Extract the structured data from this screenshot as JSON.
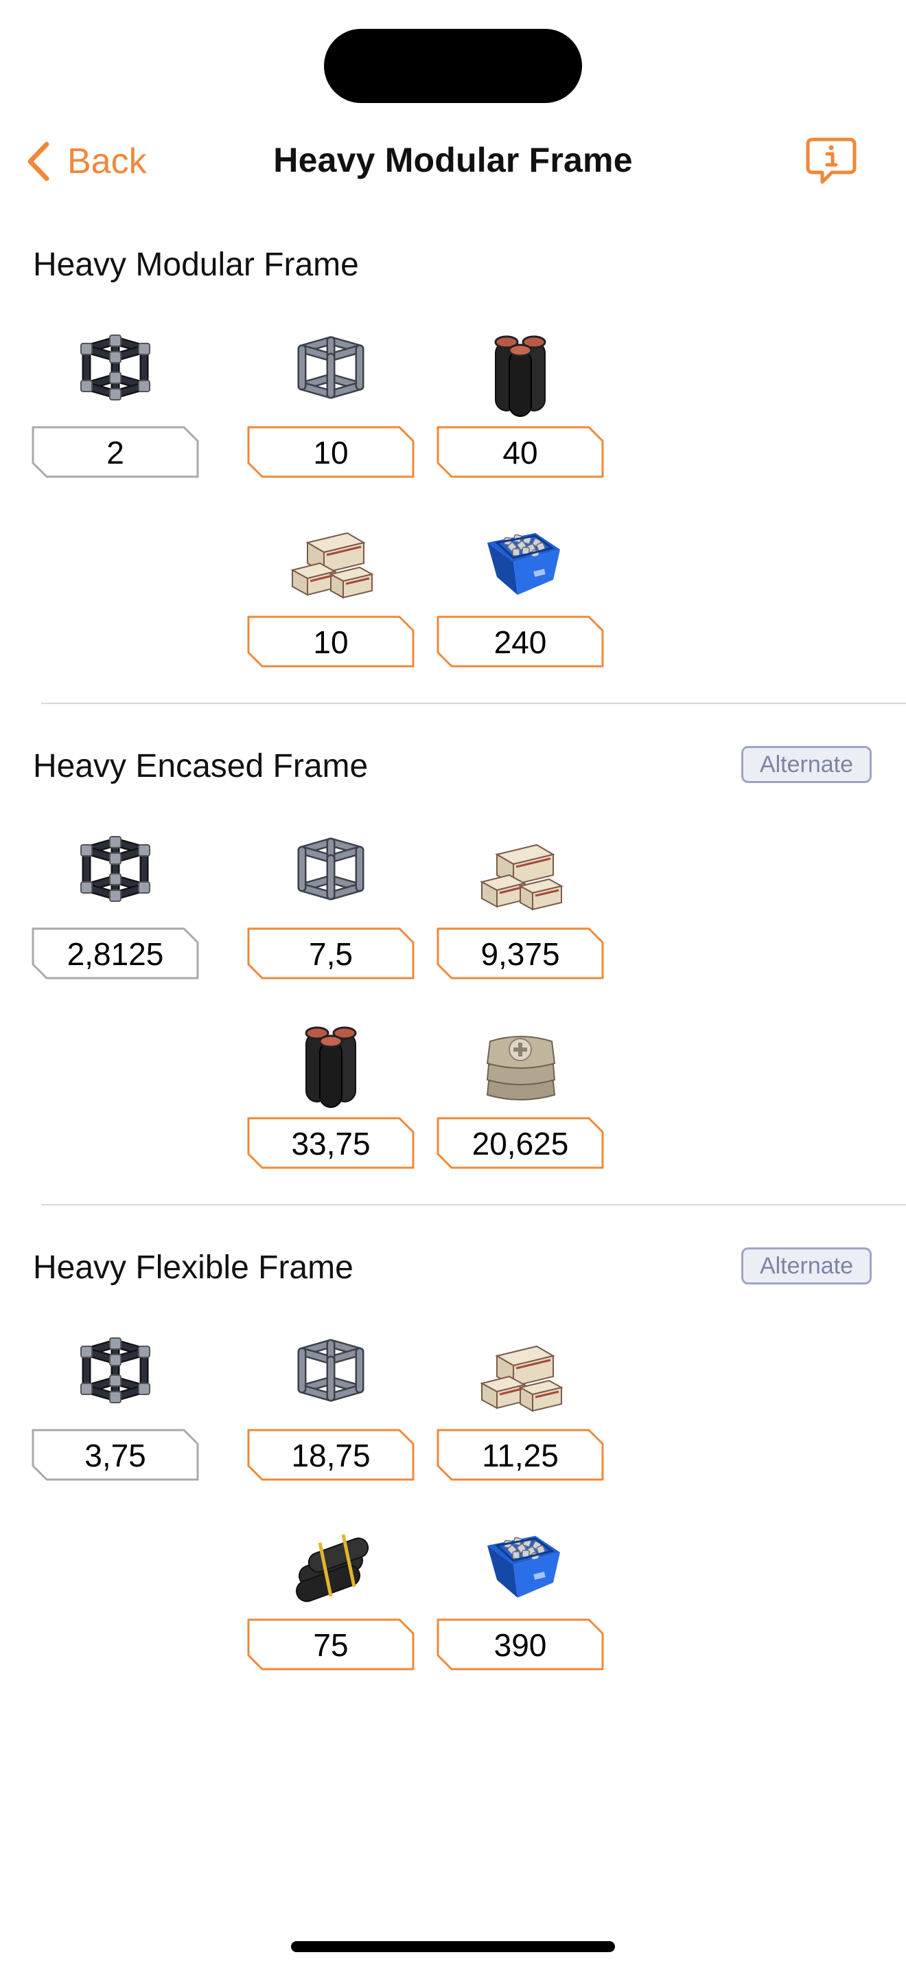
{
  "nav": {
    "back_label": "Back",
    "title": "Heavy Modular Frame",
    "info_icon": "info-bubble-icon",
    "accent_color": "#f0883a"
  },
  "colors": {
    "output_border": "#a9a9a9",
    "input_border": "#f0883a",
    "badge_border": "#9ea5c4"
  },
  "recipes": [
    {
      "name": "Heavy Modular Frame",
      "badge": "",
      "output": {
        "item": "heavy-modular-frame",
        "qty": "2"
      },
      "inputs": [
        {
          "item": "modular-frame",
          "qty": "10"
        },
        {
          "item": "steel-pipe",
          "qty": "40"
        },
        {
          "item": "encased-industrial-beam",
          "qty": "10"
        },
        {
          "item": "screw",
          "qty": "240"
        }
      ]
    },
    {
      "name": "Heavy Encased Frame",
      "badge": "Alternate",
      "output": {
        "item": "heavy-modular-frame",
        "qty": "2,8125"
      },
      "inputs": [
        {
          "item": "modular-frame",
          "qty": "7,5"
        },
        {
          "item": "encased-industrial-beam",
          "qty": "9,375"
        },
        {
          "item": "steel-pipe",
          "qty": "33,75"
        },
        {
          "item": "concrete",
          "qty": "20,625"
        }
      ]
    },
    {
      "name": "Heavy Flexible Frame",
      "badge": "Alternate",
      "output": {
        "item": "heavy-modular-frame",
        "qty": "3,75"
      },
      "inputs": [
        {
          "item": "modular-frame",
          "qty": "18,75"
        },
        {
          "item": "encased-industrial-beam",
          "qty": "11,25"
        },
        {
          "item": "rubber",
          "qty": "75"
        },
        {
          "item": "screw",
          "qty": "390"
        }
      ]
    }
  ]
}
